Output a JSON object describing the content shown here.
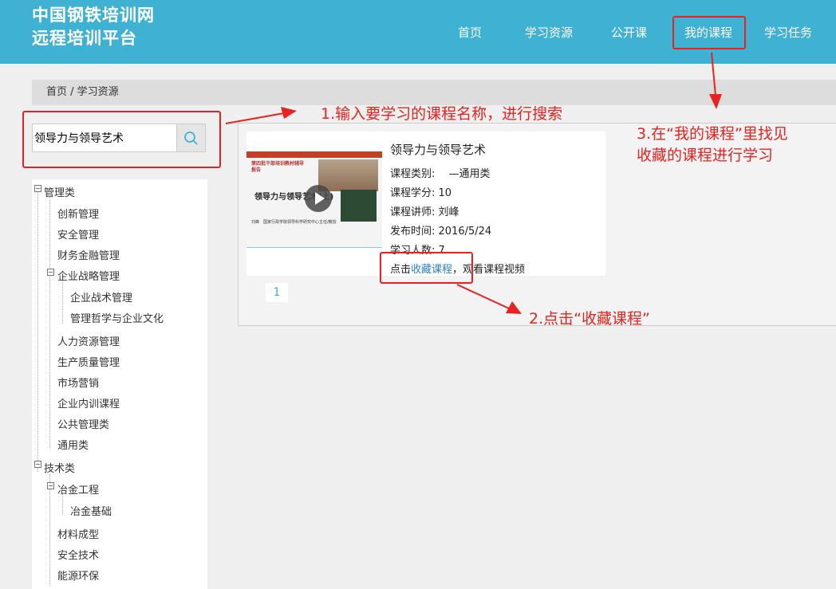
{
  "header": {
    "logo_line1": "中国钢铁培训网",
    "logo_line2": "远程培训平台",
    "nav": [
      "首页",
      "学习资源",
      "公开课",
      "我的课程",
      "学习任务"
    ]
  },
  "breadcrumb": "首页 / 学习资源",
  "search": {
    "value": "领导力与领导艺术"
  },
  "tree": {
    "cat1": "管理类",
    "cat1_items": [
      "创新管理",
      "安全管理",
      "财务金融管理",
      "企业战略管理",
      "企业战术管理",
      "管理哲学与企业文化",
      "人力资源管理",
      "生产质量管理",
      "市场营销",
      "企业内训课程",
      "公共管理类",
      "通用类"
    ],
    "cat2": "技术类",
    "cat2_items": [
      "冶金工程",
      "冶金基础",
      "材料成型",
      "安全技术",
      "能源环保"
    ]
  },
  "course": {
    "title": "领导力与领导艺术",
    "type": "课程类别:　 —通用类",
    "credit": "课程学分: 10",
    "teacher": "课程讲师: 刘峰",
    "date": "发布时间: 2016/5/24",
    "count": "学习人数: 7",
    "action_prefix": "点击",
    "action_link": "收藏课程",
    "action_suffix": "，观看课程视频",
    "thumb_top": "第四批干部培训教材辅导报告",
    "thumb_title": "领导力与领导艺术(上)",
    "thumb_bottom": "刘峰　国家行政学院领导科学研究中心主任/教授"
  },
  "pagination": "1",
  "annotations": {
    "a1": "1.输入要学习的课程名称，进行搜索",
    "a2": "2.点击“收藏课程”",
    "a3_line1": "3.在“我的课程”里找见",
    "a3_line2": "收藏的课程进行学习"
  },
  "colors": {
    "header": "#3fb1d3",
    "annotation": "#e8231f",
    "link": "#2f80c4"
  }
}
